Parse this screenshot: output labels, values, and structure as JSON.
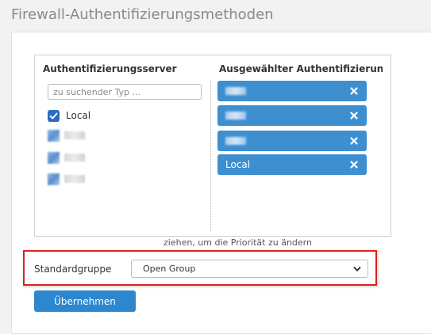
{
  "page": {
    "title": "Firewall-Authentifizierungsmethoden"
  },
  "auth_panel": {
    "left_header": "Authentifizierungsserver",
    "right_header": "Ausgewählter Authentifizierung...",
    "search_placeholder": "zu suchender Typ ...",
    "available_servers": [
      {
        "label": "Local",
        "checked": true
      },
      {
        "label": "",
        "blurred": true
      },
      {
        "label": "",
        "blurred": true
      },
      {
        "label": "",
        "blurred": true
      }
    ],
    "selected_servers": [
      {
        "label": "",
        "blurred": true
      },
      {
        "label": "",
        "blurred": true
      },
      {
        "label": "",
        "blurred": true
      },
      {
        "label": "Local",
        "blurred": false
      }
    ],
    "hint": "ziehen, um die Priorität zu ändern"
  },
  "default_group": {
    "label": "Standardgruppe",
    "selected": "Open Group"
  },
  "actions": {
    "apply_label": "Übernehmen"
  },
  "colors": {
    "accent": "#2c87cf",
    "chip": "#3d8fd0",
    "highlight": "#d9231f",
    "checkbox": "#2b6cc4"
  },
  "icons": {
    "remove": "close-icon",
    "checkbox": "checkmark-icon",
    "dropdown": "chevron-down-icon"
  }
}
